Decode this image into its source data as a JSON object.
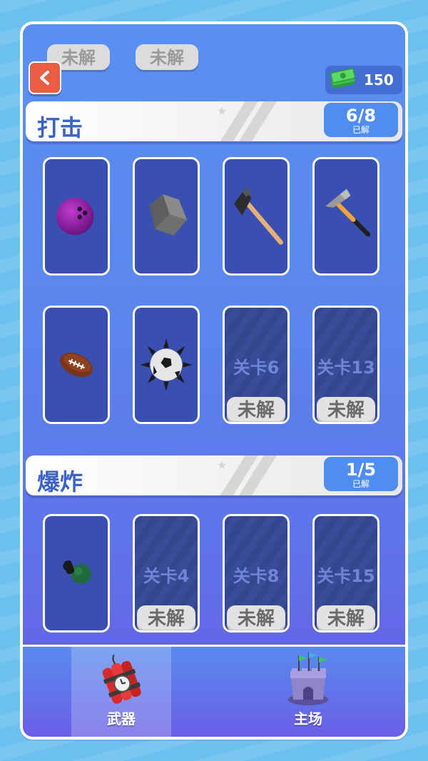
{
  "top_peek": [
    "未解",
    "未解"
  ],
  "header": {
    "cash_value": "150"
  },
  "sections": [
    {
      "title": "打击",
      "count": "6/8",
      "count_label": "已解",
      "items": [
        {
          "kind": "weapon",
          "icon": "bowling-ball-icon"
        },
        {
          "kind": "weapon",
          "icon": "rock-icon"
        },
        {
          "kind": "weapon",
          "icon": "axe-icon"
        },
        {
          "kind": "weapon",
          "icon": "hammer-icon"
        },
        {
          "kind": "weapon",
          "icon": "football-icon"
        },
        {
          "kind": "weapon",
          "icon": "spiked-ball-icon"
        },
        {
          "kind": "locked",
          "level": "关卡6",
          "lock_label": "未解"
        },
        {
          "kind": "locked",
          "level": "关卡13",
          "lock_label": "未解"
        }
      ]
    },
    {
      "title": "爆炸",
      "count": "1/5",
      "count_label": "已解",
      "items": [
        {
          "kind": "weapon",
          "icon": "grenade-icon"
        },
        {
          "kind": "locked",
          "level": "关卡4",
          "lock_label": "未解"
        },
        {
          "kind": "locked",
          "level": "关卡8",
          "lock_label": "未解"
        },
        {
          "kind": "locked",
          "level": "关卡15",
          "lock_label": "未解"
        }
      ]
    }
  ],
  "nav": [
    {
      "label": "武器",
      "icon": "dynamite-icon",
      "active": true
    },
    {
      "label": "主场",
      "icon": "castle-icon",
      "active": false
    }
  ],
  "colors": {
    "accent_blue": "#4f8df0",
    "back_button": "#ea5c43",
    "title_text": "#3b62c8"
  }
}
